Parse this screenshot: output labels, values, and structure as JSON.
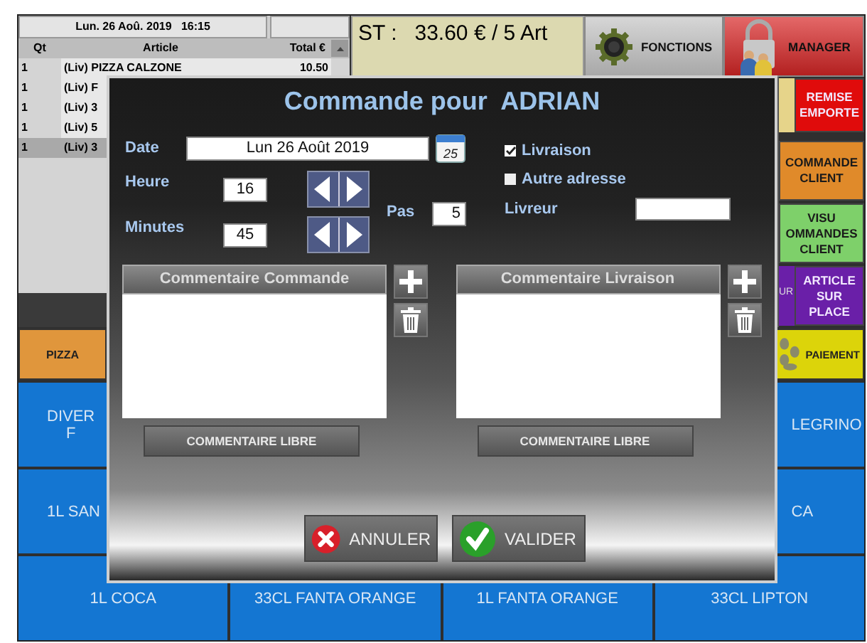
{
  "order": {
    "datetime": "Lun. 26 Aoû. 2019   16:15",
    "columns": [
      "Qt",
      "Article",
      "Total €"
    ],
    "rows": [
      {
        "qty": "1",
        "article": "(Liv) PIZZA CALZONE",
        "total": "10.50",
        "selected": false
      },
      {
        "qty": "1",
        "article": "(Liv) F",
        "selected": false
      },
      {
        "qty": "1",
        "article": "(Liv) 3",
        "selected": false
      },
      {
        "qty": "1",
        "article": "(Liv) 5",
        "selected": false
      },
      {
        "qty": "1",
        "article": "(Liv) 3",
        "selected": true
      }
    ]
  },
  "subtotal": "ST :   33.60 € / 5 Art",
  "top_buttons": [
    {
      "kind": "functions",
      "label": "FONCTIONS"
    },
    {
      "kind": "manager",
      "label": "MANAGER"
    }
  ],
  "side_buttons": [
    {
      "label": "REMISE EMPORTE",
      "color": "#e00b0b",
      "behind": {
        "color": "#e6d48a"
      }
    },
    {
      "label": "COMMANDE CLIENT",
      "color": "#e08a2a"
    },
    {
      "label": "VISU OMMANDES CLIENT",
      "color": "#7ed06a"
    },
    {
      "label": "ARTICLE SUR PLACE",
      "color": "#6a1fa8",
      "behind": {
        "color": "#6a1fa8",
        "label": "UR"
      }
    }
  ],
  "categories": [
    {
      "label": "PIZZA",
      "color": "#e0963c"
    }
  ],
  "payment_button": {
    "label": "PAIEMENT"
  },
  "products": [
    {
      "cells": [
        {
          "label": "DIVER\nF"
        },
        {
          "label": "LEGRINO"
        }
      ]
    },
    {
      "cells": [
        {
          "label": "1L SAN"
        },
        {
          "label": "CA"
        }
      ]
    },
    {
      "cells": [
        {
          "label": "1L COCA"
        },
        {
          "label": "33CL FANTA ORANGE"
        },
        {
          "label": "1L FANTA ORANGE"
        },
        {
          "label": "33CL LIPTON"
        }
      ]
    }
  ],
  "dialog": {
    "title": "Commande pour  ADRIAN",
    "date_label": "Date",
    "date": "Lun 26 Août 2019",
    "calendar_day": "25",
    "hour_label": "Heure",
    "hour": "16",
    "minutes_label": "Minutes",
    "minutes": "45",
    "step_label": "Pas",
    "step": "5",
    "options": [
      {
        "label": "Livraison",
        "checked": true
      },
      {
        "label": "Autre adresse",
        "checked": false
      }
    ],
    "courier_label": "Livreur",
    "comment_panels": [
      {
        "title": "Commentaire Commande",
        "button": "COMMENTAIRE LIBRE"
      },
      {
        "title": "Commentaire Livraison",
        "button": "COMMENTAIRE LIBRE"
      }
    ],
    "actions": [
      {
        "kind": "cancel",
        "label": "ANNULER"
      },
      {
        "kind": "confirm",
        "label": "VALIDER"
      }
    ]
  }
}
